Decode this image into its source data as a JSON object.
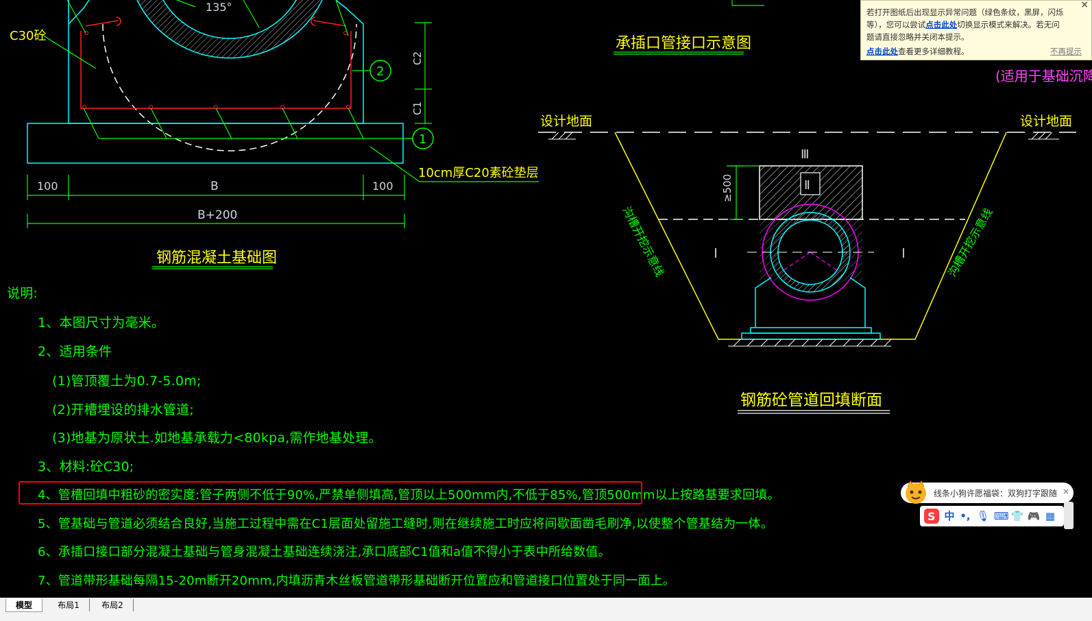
{
  "drawing": {
    "foundation": {
      "angle_label": "135°",
      "c30_label": "C30砼",
      "callout_1": "1",
      "callout_2": "2",
      "dim_c1": "C1",
      "dim_c2": "C2",
      "dim_left": "100",
      "dim_b": "B",
      "dim_right": "100",
      "dim_total": "B+200",
      "cushion_label": "10cm厚C20素砼垫层",
      "title": "钢筋混凝土基础图"
    },
    "joint": {
      "title": "承插口管接口示意图",
      "right_clip": "(适用于基础沉降"
    },
    "backfill": {
      "ground_left": "设计地面",
      "ground_right": "设计地面",
      "roman_3": "Ⅲ",
      "roman_2": "Ⅱ",
      "roman_1_left": "Ⅰ",
      "roman_1_right": "Ⅰ",
      "dim_500": "≥500",
      "slope_left": "沟槽开挖示意线",
      "slope_right": "沟槽开挖示意线",
      "title": "钢筋砼管道回填断面"
    }
  },
  "notes": {
    "title": "说明:",
    "items": [
      "1、本图尺寸为毫米。",
      "2、适用条件",
      "(1)管顶覆土为0.7-5.0m;",
      "(2)开槽埋设的排水管道;",
      "(3)地基为原状土.如地基承载力<80kpa,需作地基处理。",
      "3、材料:砼C30;",
      "4、管槽回填中粗砂的密实度:管子两侧不低于90%,严禁单侧填高,管顶以上500mm内,不低于85%,管顶500mm以上按路基要求回填。",
      "5、管基础与管道必须结合良好,当施工过程中需在C1层面处留施工缝时,则在继续施工时应将间歇面凿毛刷净,以使整个管基结为一体。",
      "6、承插口接口部分混凝土基础与管身混凝土基础连续浇注,承口底部C1值和a值不得小于表中所给数值。",
      "7、管道带形基础每隔15-20m断开20mm,内填沥青木丝板管道带形基础断开位置应和管道接口位置处于同一面上。"
    ]
  },
  "notification": {
    "line1": "若打开图纸后出现显示异常问题（绿色条纹，黑屏，闪烁等），您可以尝试",
    "link1": "点击此处",
    "line2": "切换显示模式来解决。若无问题请直接忽略并关闭本提示。",
    "link2": "点击此处",
    "more": "查看更多详细教程。",
    "dismiss": "不再提示",
    "close": "×"
  },
  "ime": {
    "tip": "线条小狗许愿福袋：双狗打字跟随",
    "close": "×",
    "lang": "中",
    "punct": "•,",
    "mic": "🎙",
    "keyboard": "⌨",
    "skin": "👕",
    "game": "🎮",
    "grid": "▦"
  },
  "tabs": [
    "模型",
    "布局1",
    "布局2"
  ],
  "colors": {
    "background": "#000000",
    "cyan": "#00ffff",
    "yellow": "#ffff00",
    "green": "#00ff00",
    "red_rebar": "#ff2020",
    "magenta": "#ff00ff",
    "highlight_box": "#ff0000"
  }
}
